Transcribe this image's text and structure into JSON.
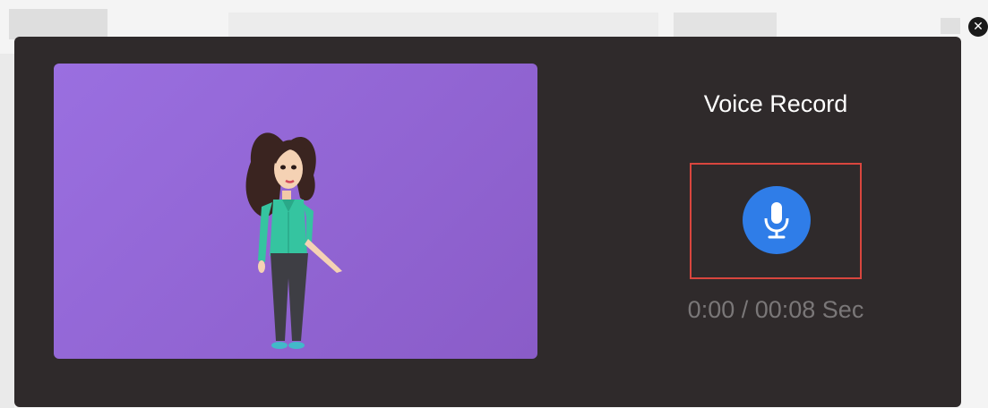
{
  "modal": {
    "title": "Voice Record",
    "timer": "0:00 / 00:08 Sec",
    "close_icon": "close-icon",
    "mic_icon": "microphone-icon"
  },
  "colors": {
    "modal_background": "#2f2a2b",
    "preview_gradient_start": "#9a6fe0",
    "preview_gradient_end": "#8a5cc8",
    "mic_button": "#2f7de8",
    "highlight_border": "#d9463e",
    "timer_text": "#7a7778"
  }
}
